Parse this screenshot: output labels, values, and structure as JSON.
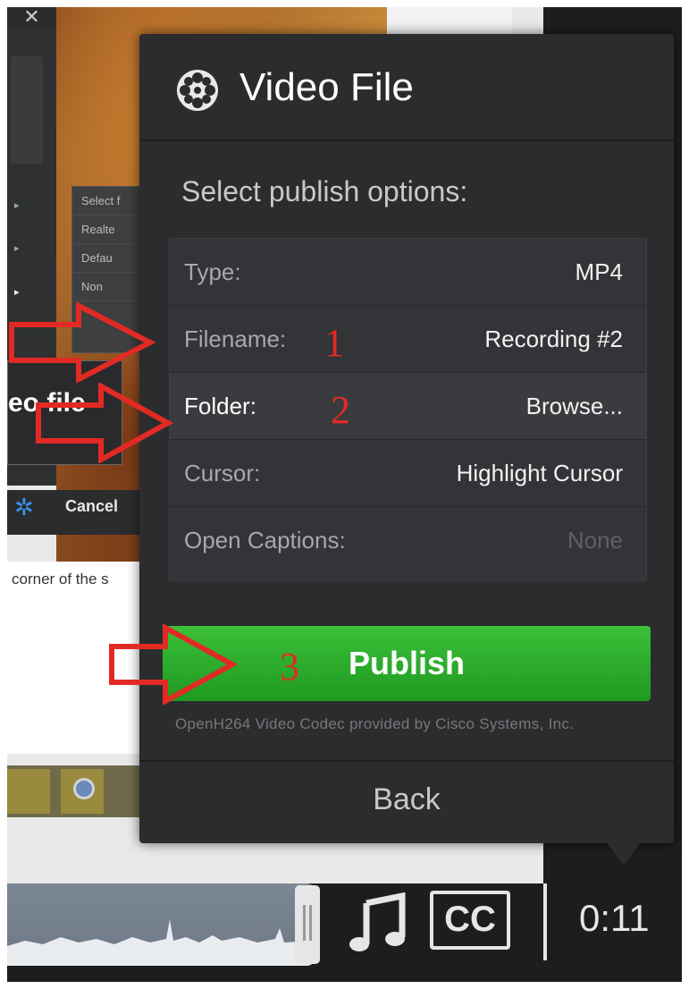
{
  "background_app": {
    "close_glyph": "✕",
    "menu_items": [
      "Select f",
      "Realte",
      "Defau",
      "Non"
    ],
    "tooltip_text": "eo file",
    "cancel_label": "Cancel",
    "page_text": "corner of the s"
  },
  "dialog": {
    "title": "Video File",
    "subtitle": "Select publish options:",
    "options": [
      {
        "label": "Type:",
        "value": "MP4"
      },
      {
        "label": "Filename:",
        "value": "Recording #2"
      },
      {
        "label": "Folder:",
        "value": "Browse..."
      },
      {
        "label": "Cursor:",
        "value": "Highlight Cursor"
      },
      {
        "label": "Open Captions:",
        "value": "None"
      }
    ],
    "publish_label": "Publish",
    "codec_note": "OpenH264 Video Codec provided by Cisco Systems, Inc.",
    "back_label": "Back",
    "icon": "film-reel-icon"
  },
  "toolbar": {
    "cc_label": "CC",
    "time": "0:11",
    "icons": [
      "music-icon",
      "closed-captions-icon"
    ]
  },
  "annotations": {
    "step1": "1",
    "step2": "2",
    "step3": "3",
    "color": "#e22a24"
  },
  "colors": {
    "publish_green": "#2db12c",
    "dialog_bg": "#2b2c2e"
  }
}
